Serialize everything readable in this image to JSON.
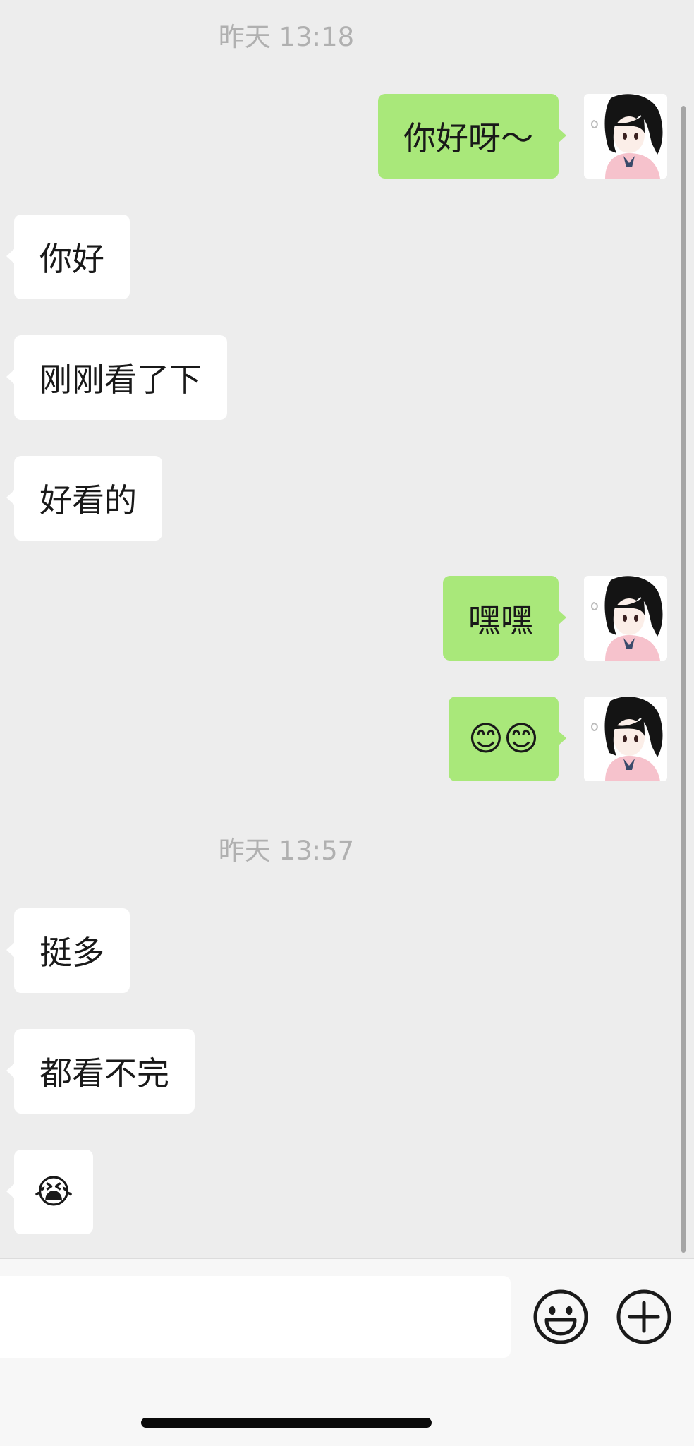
{
  "timestamps": [
    "昨天 13:18",
    "昨天 13:57"
  ],
  "messages": [
    {
      "side": "out",
      "text": "你好呀～"
    },
    {
      "side": "in",
      "text": "你好"
    },
    {
      "side": "in",
      "text": "刚刚看了下"
    },
    {
      "side": "in",
      "text": "好看的"
    },
    {
      "side": "out",
      "text": "嘿嘿"
    },
    {
      "side": "out",
      "text": "😊😊"
    },
    {
      "side": "in",
      "text": "挺多"
    },
    {
      "side": "in",
      "text": "都看不完"
    },
    {
      "side": "in",
      "text": "😭"
    }
  ],
  "input": {
    "value": "",
    "placeholder": ""
  },
  "icons": {
    "emoji_button": "smiley-face-icon",
    "more_button": "plus-circle-icon",
    "avatar": "anime-girl-avatar"
  },
  "colors": {
    "background": "#ededed",
    "outgoing_bubble": "#a9e87a",
    "incoming_bubble": "#ffffff",
    "timestamp": "#b0b0b0"
  }
}
